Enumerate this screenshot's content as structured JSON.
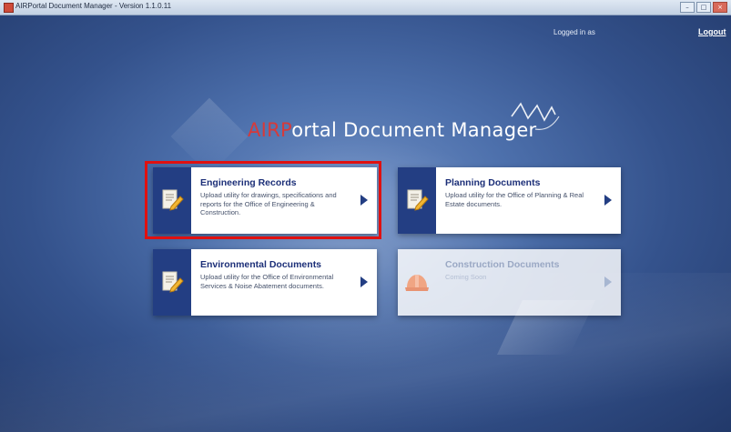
{
  "window": {
    "title": "AIRPortal Document Manager - Version 1.1.0.11",
    "controls": [
      "–",
      "□",
      "×"
    ]
  },
  "header": {
    "logged_in_label": "Logged in as",
    "logout_label": "Logout"
  },
  "app_title": {
    "accent": "AIRP",
    "rest": "ortal Document Manager"
  },
  "cards": [
    {
      "title": "Engineering Records",
      "description": "Upload utility for drawings, specifications and reports for the Office of Engineering & Construction.",
      "icon": "document-pencil-icon",
      "enabled": true,
      "highlighted": true
    },
    {
      "title": "Planning Documents",
      "description": "Upload utility for the Office of Planning & Real Estate documents.",
      "icon": "document-pencil-icon",
      "enabled": true
    },
    {
      "title": "Environmental Documents",
      "description": "Upload utility for the Office of Environmental Services & Noise Abatement documents.",
      "icon": "document-pencil-icon",
      "enabled": true
    },
    {
      "title": "Construction Documents",
      "description": "Coming Soon",
      "icon": "hard-hat-icon",
      "enabled": false
    }
  ],
  "colors": {
    "accent_red": "#d63a3a",
    "tile_blue": "#233e83",
    "highlight_red": "#e01010",
    "background_blue": "#4d70ac"
  }
}
